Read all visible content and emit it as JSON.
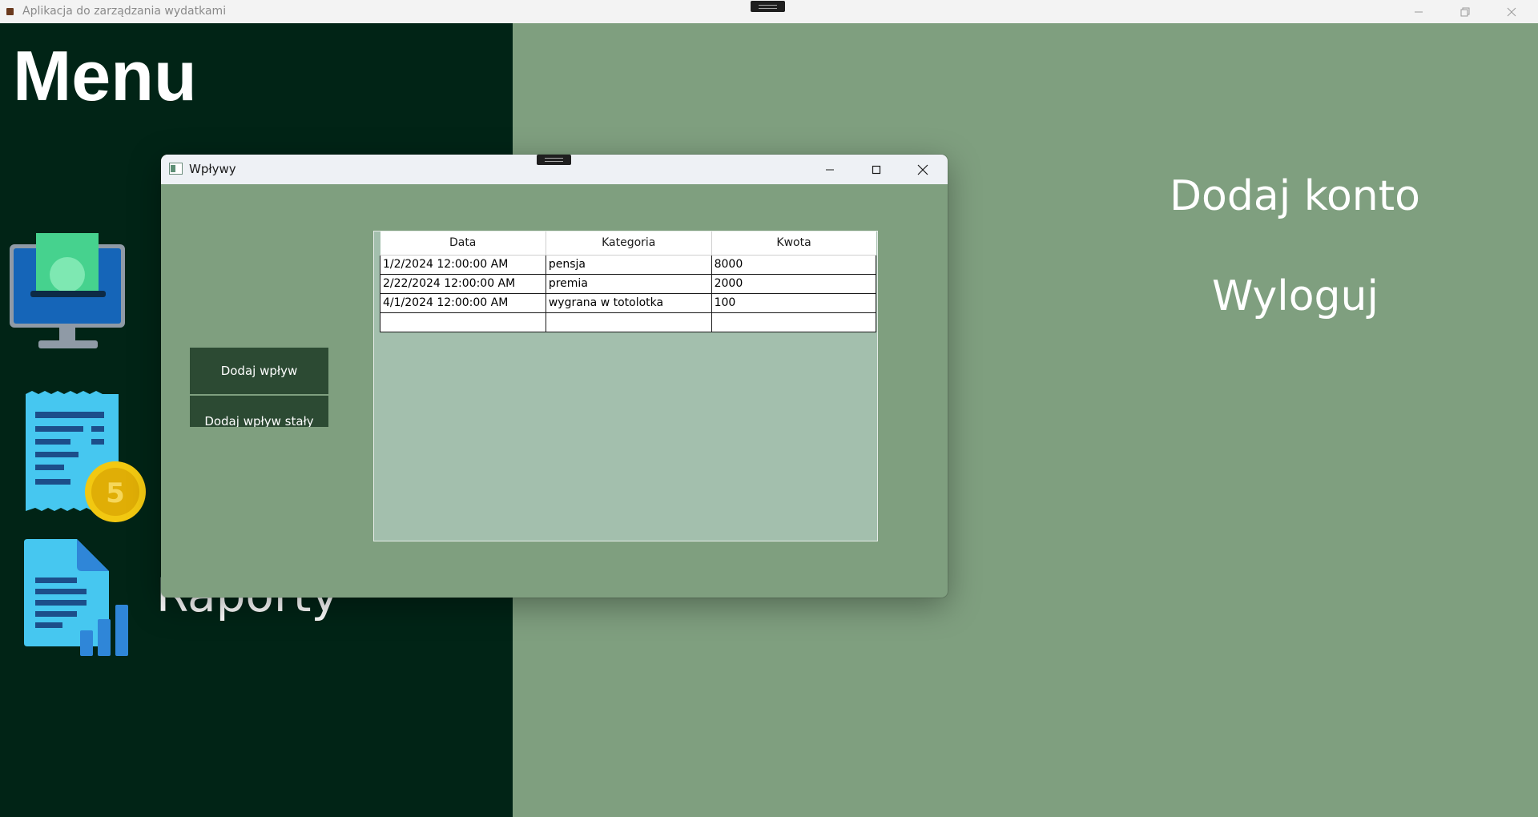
{
  "main_window": {
    "title": "Aplikacja do zarządzania wydatkami"
  },
  "menu": {
    "title": "Menu",
    "items": [
      {
        "label": "Raporty",
        "icon": "report-chart-icon"
      }
    ],
    "icons": [
      "monitor-cash-icon",
      "receipt-coin-icon",
      "report-chart-icon"
    ]
  },
  "content": {
    "add_account": "Dodaj konto",
    "logout": "Wyloguj"
  },
  "dialog": {
    "title": "Wpływy",
    "buttons": {
      "add_income": "Dodaj wpływ",
      "add_fixed_income": "Dodaj wpływ stały"
    },
    "grid": {
      "columns": [
        "Data",
        "Kategoria",
        "Kwota"
      ],
      "rows": [
        [
          "1/2/2024 12:00:00 AM",
          "pensja",
          "8000"
        ],
        [
          "2/22/2024 12:00:00 AM",
          "premia",
          "2000"
        ],
        [
          "4/1/2024 12:00:00 AM",
          "wygrana w totolotka",
          "100"
        ],
        [
          "",
          "",
          ""
        ]
      ]
    }
  },
  "colors": {
    "menu_bg": "#012416",
    "content_bg": "#7f9f7f",
    "button_bg": "#2c4a33",
    "grid_bg": "#a3bfad",
    "coin": "#f2c811",
    "icon_cyan": "#4fd8ff"
  }
}
